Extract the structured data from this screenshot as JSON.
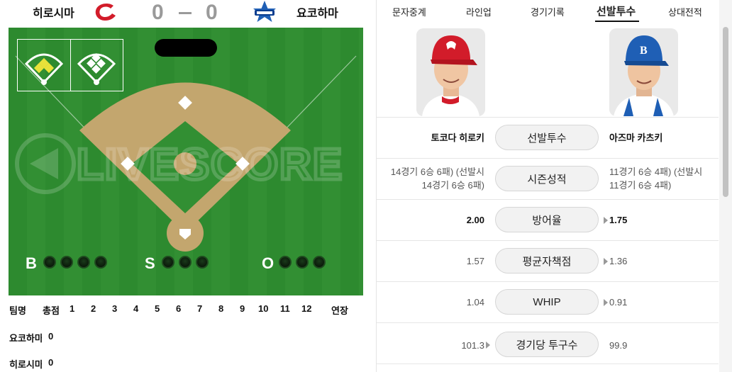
{
  "scoreboard": {
    "home_team": "히로시마",
    "away_team": "요코하마",
    "home_score": "0",
    "away_score": "0",
    "home_logo": "hiroshima-carp-logo",
    "away_logo": "yokohama-baystars-logo"
  },
  "field": {
    "watermark": "LIVESCORE",
    "count_labels": {
      "balls": "B",
      "strikes": "S",
      "outs": "O"
    },
    "balls": 0,
    "strikes": 0,
    "outs": 0,
    "colors": {
      "grass": "#2d8a2f",
      "dirt": "#c3a66e"
    }
  },
  "inning_table": {
    "headers": [
      "팀명",
      "총점",
      "1",
      "2",
      "3",
      "4",
      "5",
      "6",
      "7",
      "8",
      "9",
      "10",
      "11",
      "12",
      "연장"
    ],
    "rows": [
      {
        "team": "요코하마",
        "total": "0"
      },
      {
        "team": "히로시마",
        "total": "0"
      }
    ]
  },
  "tabs": [
    {
      "label": "문자중계",
      "active": false
    },
    {
      "label": "라인업",
      "active": false
    },
    {
      "label": "경기기록",
      "active": false
    },
    {
      "label": "선발투수",
      "active": true
    },
    {
      "label": "상대전적",
      "active": false
    }
  ],
  "pitchers": {
    "left_photo": "pitcher-photo-hiroshima",
    "right_photo": "pitcher-photo-yokohama",
    "rows": [
      {
        "label": "선발투수",
        "left": "토코다 히로키",
        "right": "아즈마 카츠키",
        "left_bold": true,
        "right_bold": true
      },
      {
        "label": "시즌성적",
        "left": "14경기 6승 6패) (선발시\n14경기 6승 6패)",
        "right": "11경기 6승 4패) (선발시\n11경기 6승 4패)",
        "left_bold": false,
        "right_bold": false
      },
      {
        "label": "방어율",
        "left": "2.00",
        "right": "1.75",
        "left_bold": true,
        "right_bold": true
      },
      {
        "label": "평균자책점",
        "left": "1.57",
        "right": "1.36",
        "left_bold": false,
        "right_bold": false
      },
      {
        "label": "WHIP",
        "left": "1.04",
        "right": "0.91",
        "left_bold": false,
        "right_bold": false
      },
      {
        "label": "경기당 투구수",
        "left": "101.3",
        "right": "99.9",
        "left_bold": false,
        "right_bold": false
      }
    ]
  }
}
